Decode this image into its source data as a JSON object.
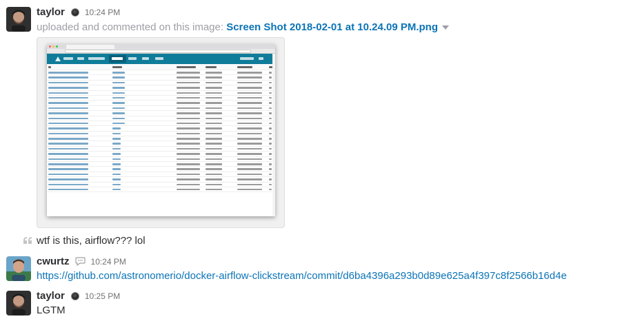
{
  "messages": [
    {
      "author": "taylor",
      "status": "away",
      "time": "10:24 PM",
      "upload_prefix": "uploaded and commented on this image:",
      "file_name": "Screen Shot 2018-02-01 at 10.24.09 PM.png",
      "comment": "wtf is this, airflow??? lol"
    },
    {
      "author": "cwurtz",
      "status": "comment",
      "time": "10:24 PM",
      "link": "https://github.com/astronomerio/docker-airflow-clickstream/commit/d6ba4396a293b0d89e625a4f397c8f2566b16d4e"
    },
    {
      "author": "taylor",
      "status": "away",
      "time": "10:25 PM",
      "text": "LGTM"
    }
  ],
  "icons": {
    "status_away": "away-status-icon",
    "status_comment": "comment-icon",
    "file_menu": "chevron-down-icon"
  },
  "colors": {
    "link": "#0b74b7",
    "airflow_nav": "#0f7c9a",
    "muted": "#9e9ea6"
  }
}
